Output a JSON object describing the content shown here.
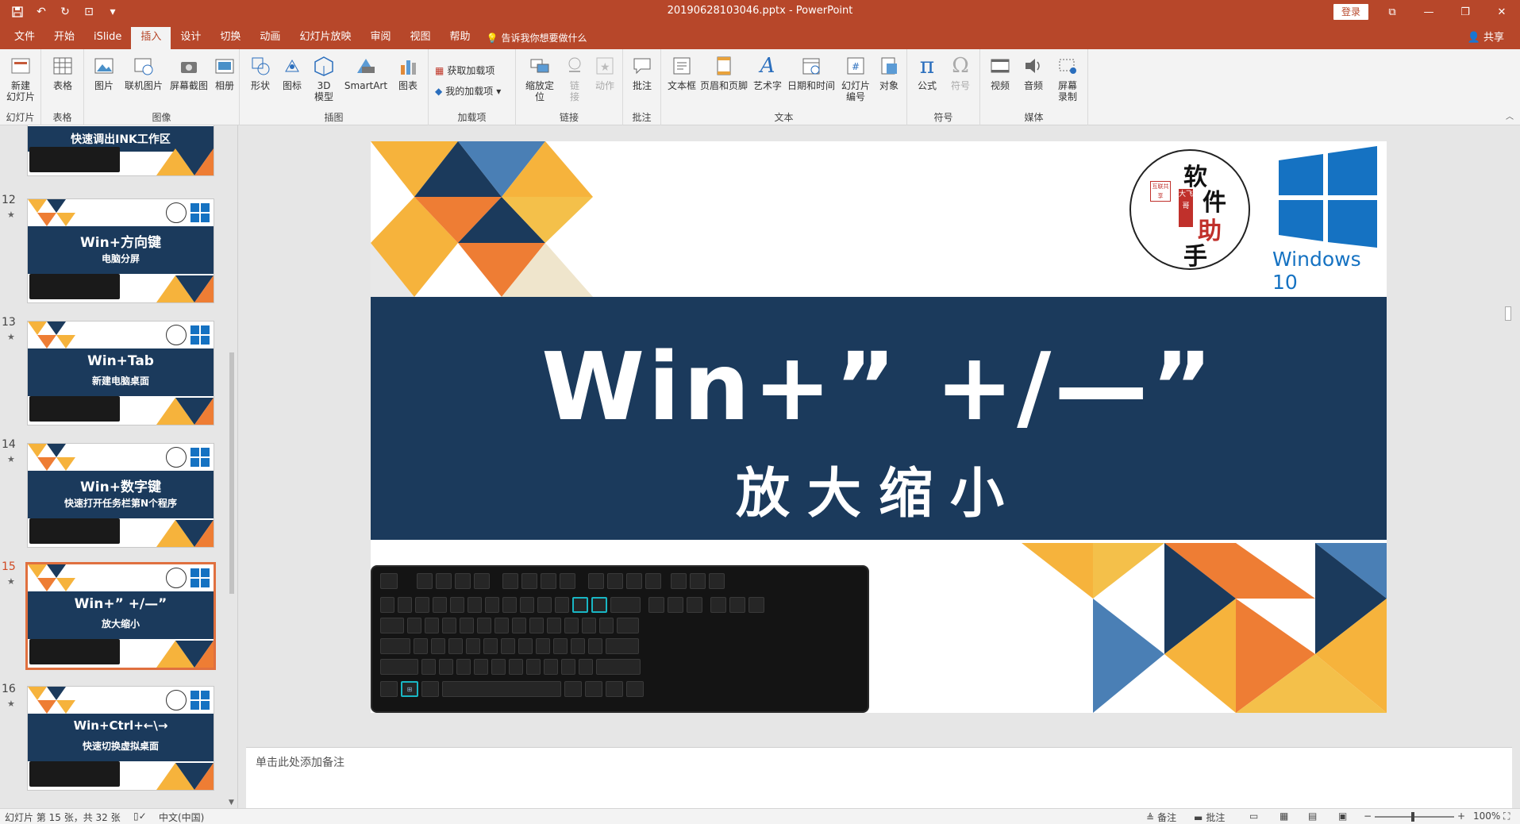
{
  "window": {
    "title": "20190628103046.pptx  -  PowerPoint",
    "login": "登录",
    "share": "共享"
  },
  "tabs": [
    "文件",
    "开始",
    "iSlide",
    "插入",
    "设计",
    "切换",
    "动画",
    "幻灯片放映",
    "审阅",
    "视图",
    "帮助"
  ],
  "active_tab": "插入",
  "tellme": "告诉我你想要做什么",
  "ribbon": {
    "groups": {
      "slides": "幻灯片",
      "tables": "表格",
      "images": "图像",
      "illustrations": "插图",
      "addins": "加载项",
      "links": "链接",
      "comments": "批注",
      "text": "文本",
      "symbols": "符号",
      "media": "媒体"
    },
    "buttons": {
      "new_slide_1": "新建",
      "new_slide_2": "幻灯片",
      "table": "表格",
      "picture": "图片",
      "online_picture": "联机图片",
      "screenshot": "屏幕截图",
      "album": "相册",
      "shapes": "形状",
      "icons": "图标",
      "model3d_1": "3D",
      "model3d_2": "模型",
      "smartart": "SmartArt",
      "chart": "图表",
      "get_addins": "获取加载项",
      "my_addins": "我的加载项",
      "zoom_1": "缩放定",
      "zoom_2": "位",
      "link_1": "链",
      "link_2": "接",
      "action": "动作",
      "comment": "批注",
      "textbox": "文本框",
      "header_footer": "页眉和页脚",
      "wordart": "艺术字",
      "datetime": "日期和时间",
      "slide_number_1": "幻灯片",
      "slide_number_2": "编号",
      "object": "对象",
      "equation": "公式",
      "symbol": "符号",
      "video": "视频",
      "audio": "音频",
      "screen_rec_1": "屏幕",
      "screen_rec_2": "录制"
    }
  },
  "thumbnails": [
    {
      "number": "",
      "title": "快速调出INK工作区",
      "subtitle": ""
    },
    {
      "number": "12",
      "title": "Win+方向键",
      "subtitle": "电脑分屏"
    },
    {
      "number": "13",
      "title": "Win+Tab",
      "subtitle": "新建电脑桌面"
    },
    {
      "number": "14",
      "title": "Win+数字键",
      "subtitle": "快速打开任务栏第N个程序"
    },
    {
      "number": "15",
      "title": "Win+” +/—”",
      "subtitle": "放大缩小"
    },
    {
      "number": "16",
      "title": "Win+Ctrl+←\\→",
      "subtitle": "快速切换虚拟桌面"
    }
  ],
  "slide": {
    "title": "Win+” +/—”",
    "subtitle": "放大缩小",
    "badge_chars": [
      "软",
      "件",
      "助",
      "手"
    ],
    "badge_seal": "大飞哥",
    "badge_stamp": "互联共享",
    "win_label": "Windows 10"
  },
  "notes_placeholder": "单击此处添加备注",
  "status": {
    "slide_info": "幻灯片 第 15 张，共 32 张",
    "language": "中文(中国)",
    "notes": "备注",
    "comments": "批注",
    "zoom": "100%"
  },
  "colors": {
    "accent": "#b7472a",
    "navy": "#1b3a5c",
    "orange": "#ee7d34",
    "yellow": "#f6b33c",
    "blue": "#4a7fb5"
  }
}
